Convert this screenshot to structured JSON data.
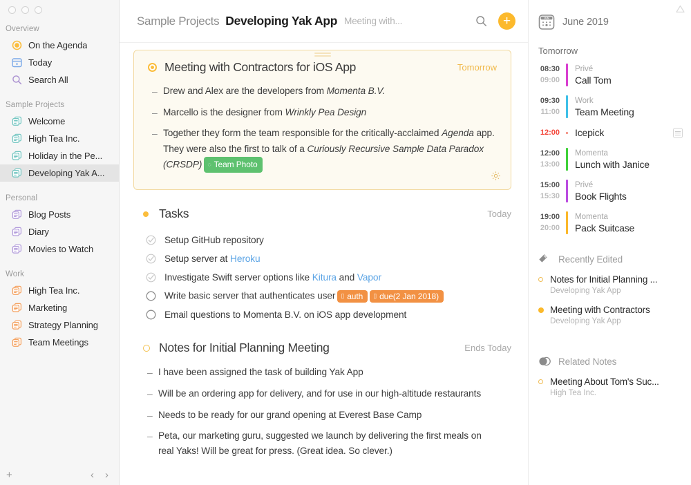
{
  "window": {
    "traffic_lights": [
      "close",
      "minimize",
      "zoom"
    ],
    "collapse_icon": "collapse-triangle-icon"
  },
  "sidebar": {
    "groups": [
      {
        "label": "Overview",
        "items": [
          {
            "label": "On the Agenda",
            "icon": "agenda-target-icon",
            "selected": false
          },
          {
            "label": "Today",
            "icon": "calendar-icon",
            "selected": false
          },
          {
            "label": "Search All",
            "icon": "search-icon",
            "selected": false
          }
        ]
      },
      {
        "label": "Sample Projects",
        "items": [
          {
            "label": "Welcome",
            "icon": "notes-stack-icon",
            "selected": false
          },
          {
            "label": "High Tea Inc.",
            "icon": "notes-stack-icon",
            "selected": false
          },
          {
            "label": "Holiday in the Pe...",
            "icon": "notes-stack-icon",
            "selected": false
          },
          {
            "label": "Developing Yak A...",
            "icon": "notes-stack-icon",
            "selected": true
          }
        ]
      },
      {
        "label": "Personal",
        "items": [
          {
            "label": "Blog Posts",
            "icon": "notes-stack-icon",
            "selected": false
          },
          {
            "label": "Diary",
            "icon": "notes-stack-icon",
            "selected": false
          },
          {
            "label": "Movies to Watch",
            "icon": "notes-stack-icon",
            "selected": false
          }
        ]
      },
      {
        "label": "Work",
        "items": [
          {
            "label": "High Tea Inc.",
            "icon": "notes-stack-icon",
            "selected": false
          },
          {
            "label": "Marketing",
            "icon": "notes-stack-icon",
            "selected": false
          },
          {
            "label": "Strategy Planning",
            "icon": "notes-stack-icon",
            "selected": false
          },
          {
            "label": "Team Meetings",
            "icon": "notes-stack-icon",
            "selected": false
          }
        ]
      }
    ],
    "footer": {
      "add_label": "+",
      "back_label": "‹",
      "forward_label": "›"
    }
  },
  "header": {
    "breadcrumb_project": "Sample Projects",
    "title": "Developing Yak App",
    "subtitle": "Meeting with...",
    "search_icon": "search-icon",
    "add_label": "+"
  },
  "note_card": {
    "title": "Meeting with Contractors for iOS App",
    "when": "Tomorrow",
    "bullets": [
      {
        "dash": "–",
        "segments": [
          {
            "text": "Drew and Alex are the developers from ",
            "style": "normal"
          },
          {
            "text": "Momenta B.V.",
            "style": "italic"
          }
        ]
      },
      {
        "dash": "–",
        "segments": [
          {
            "text": "Marcello is the designer from ",
            "style": "normal"
          },
          {
            "text": "Wrinkly Pea Design",
            "style": "italic"
          }
        ]
      },
      {
        "dash": "–",
        "segments": [
          {
            "text": "Together they form the team responsible for the critically-acclaimed ",
            "style": "normal"
          },
          {
            "text": "Agenda",
            "style": "italic"
          },
          {
            "text": " app. They were also the first to talk of a ",
            "style": "normal"
          },
          {
            "text": "Curiously Recursive Sample Data Paradox (CRSDP)",
            "style": "italic"
          }
        ],
        "tag": {
          "label": "Team Photo",
          "color": "green",
          "icon": "people-tag-icon"
        }
      }
    ],
    "gear_icon": "gear-icon",
    "drag_handle_icon": "drag-handle-icon"
  },
  "tasks_section": {
    "title": "Tasks",
    "when": "Today",
    "items": [
      {
        "checked": true,
        "segments": [
          {
            "text": "Setup GitHub repository",
            "style": "normal"
          }
        ],
        "tags": []
      },
      {
        "checked": true,
        "segments": [
          {
            "text": "Setup server at ",
            "style": "normal"
          },
          {
            "text": "Heroku",
            "style": "link"
          }
        ],
        "tags": []
      },
      {
        "checked": true,
        "segments": [
          {
            "text": "Investigate Swift server options like ",
            "style": "normal"
          },
          {
            "text": "Kitura",
            "style": "link"
          },
          {
            "text": " and ",
            "style": "normal"
          },
          {
            "text": "Vapor",
            "style": "link"
          }
        ],
        "tags": []
      },
      {
        "checked": false,
        "segments": [
          {
            "text": "Write basic server that authenticates user",
            "style": "normal"
          }
        ],
        "tags": [
          {
            "label": "auth",
            "color": "orange",
            "icon": "tag-icon"
          },
          {
            "label": "due(2 Jan 2018)",
            "color": "orange",
            "icon": "tag-icon"
          }
        ]
      },
      {
        "checked": false,
        "segments": [
          {
            "text": "Email questions to Momenta B.V. on iOS app development",
            "style": "normal"
          }
        ],
        "tags": []
      }
    ]
  },
  "notes_section": {
    "title": "Notes for Initial Planning Meeting",
    "when": "Ends Today",
    "bullets": [
      {
        "dash": "–",
        "text": "I have been assigned the task of building Yak App"
      },
      {
        "dash": "–",
        "text": "Will be an ordering app for delivery, and for use in our high-altitude restaurants"
      },
      {
        "dash": "–",
        "text": "Needs to be ready for our grand opening at Everest Base Camp"
      },
      {
        "dash": "–",
        "text": "Peta, our marketing guru, suggested we launch by delivering the first meals on real Yaks! Will be great for press. (Great idea. So clever.)"
      }
    ]
  },
  "right_panel": {
    "calendar": {
      "icon": "calendar-jun-icon",
      "icon_month_abbr": "JUN",
      "month_label": "June 2019",
      "day_label": "Tomorrow",
      "events": [
        {
          "start": "08:30",
          "end": "09:00",
          "calendar": "Privé",
          "title": "Call Tom",
          "color": "#d93fd0",
          "alert": false
        },
        {
          "start": "09:30",
          "end": "11:00",
          "calendar": "Work",
          "title": "Team Meeting",
          "color": "#3fc0e8",
          "alert": false
        },
        {
          "start": "12:00",
          "end": "",
          "calendar": "",
          "title": "Icepick",
          "color": "#f27d6e",
          "alert": true,
          "note_icon": "note-icon"
        },
        {
          "start": "12:00",
          "end": "13:00",
          "calendar": "Momenta",
          "title": "Lunch with Janice",
          "color": "#3fd139",
          "alert": false
        },
        {
          "start": "15:00",
          "end": "15:30",
          "calendar": "Privé",
          "title": "Book Flights",
          "color": "#bb4ce0",
          "alert": false
        },
        {
          "start": "19:00",
          "end": "20:00",
          "calendar": "Momenta",
          "title": "Pack Suitcase",
          "color": "#fbb82b",
          "alert": false
        }
      ]
    },
    "recently_edited": {
      "icon": "eraser-icon",
      "title": "Recently Edited",
      "items": [
        {
          "title": "Notes for Initial Planning ...",
          "project": "Developing Yak App",
          "bullet": "hollow"
        },
        {
          "title": "Meeting with Contractors",
          "project": "Developing Yak App",
          "bullet": "filled"
        }
      ]
    },
    "related_notes": {
      "icon": "overlapping-circles-icon",
      "title": "Related Notes",
      "items": [
        {
          "title": "Meeting About Tom's Suc...",
          "project": "High Tea Inc.",
          "bullet": "hollow"
        }
      ]
    }
  },
  "colors": {
    "accent": "#fbb92b",
    "card_bg": "#fdfaf1",
    "card_border": "#f2d9a0",
    "link": "#5ba4e5",
    "tag_green": "#5ec16f",
    "tag_orange": "#f29143",
    "alert_red": "#f4483c",
    "sidebar_bg": "#f6f6f6",
    "selected_bg": "#e4e4e4"
  }
}
